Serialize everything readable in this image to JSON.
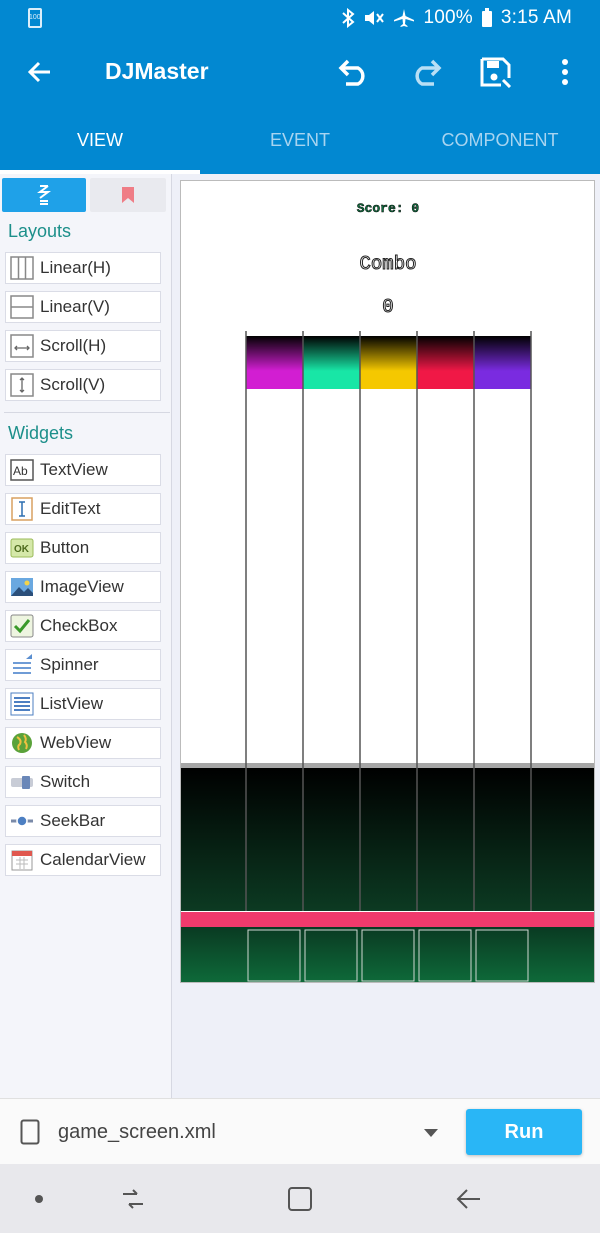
{
  "status_bar": {
    "battery_badge": "100",
    "battery_pct": "100%",
    "time": "3:15 AM"
  },
  "app_bar": {
    "title": "DJMaster"
  },
  "tabs": [
    {
      "label": "VIEW",
      "active": true
    },
    {
      "label": "EVENT",
      "active": false
    },
    {
      "label": "COMPONENT",
      "active": false
    }
  ],
  "palette": {
    "layouts_heading": "Layouts",
    "layouts": [
      "Linear(H)",
      "Linear(V)",
      "Scroll(H)",
      "Scroll(V)"
    ],
    "widgets_heading": "Widgets",
    "widgets": [
      "TextView",
      "EditText",
      "Button",
      "ImageView",
      "CheckBox",
      "Spinner",
      "ListView",
      "WebView",
      "Switch",
      "SeekBar",
      "CalendarView"
    ]
  },
  "game_preview": {
    "score_text": "Score: 0",
    "combo_label": "Combo",
    "combo_value": "0",
    "lane_colors": [
      "#d21ed2",
      "#18e6a6",
      "#f5c800",
      "#f01846",
      "#7a2be0"
    ],
    "hit_bar_color": "#f03a6c"
  },
  "bottom_bar": {
    "file_name": "game_screen.xml",
    "run_label": "Run"
  },
  "colors": {
    "primary": "#0288d1",
    "accent": "#29b6f6",
    "section_text": "#1c8f8a"
  }
}
